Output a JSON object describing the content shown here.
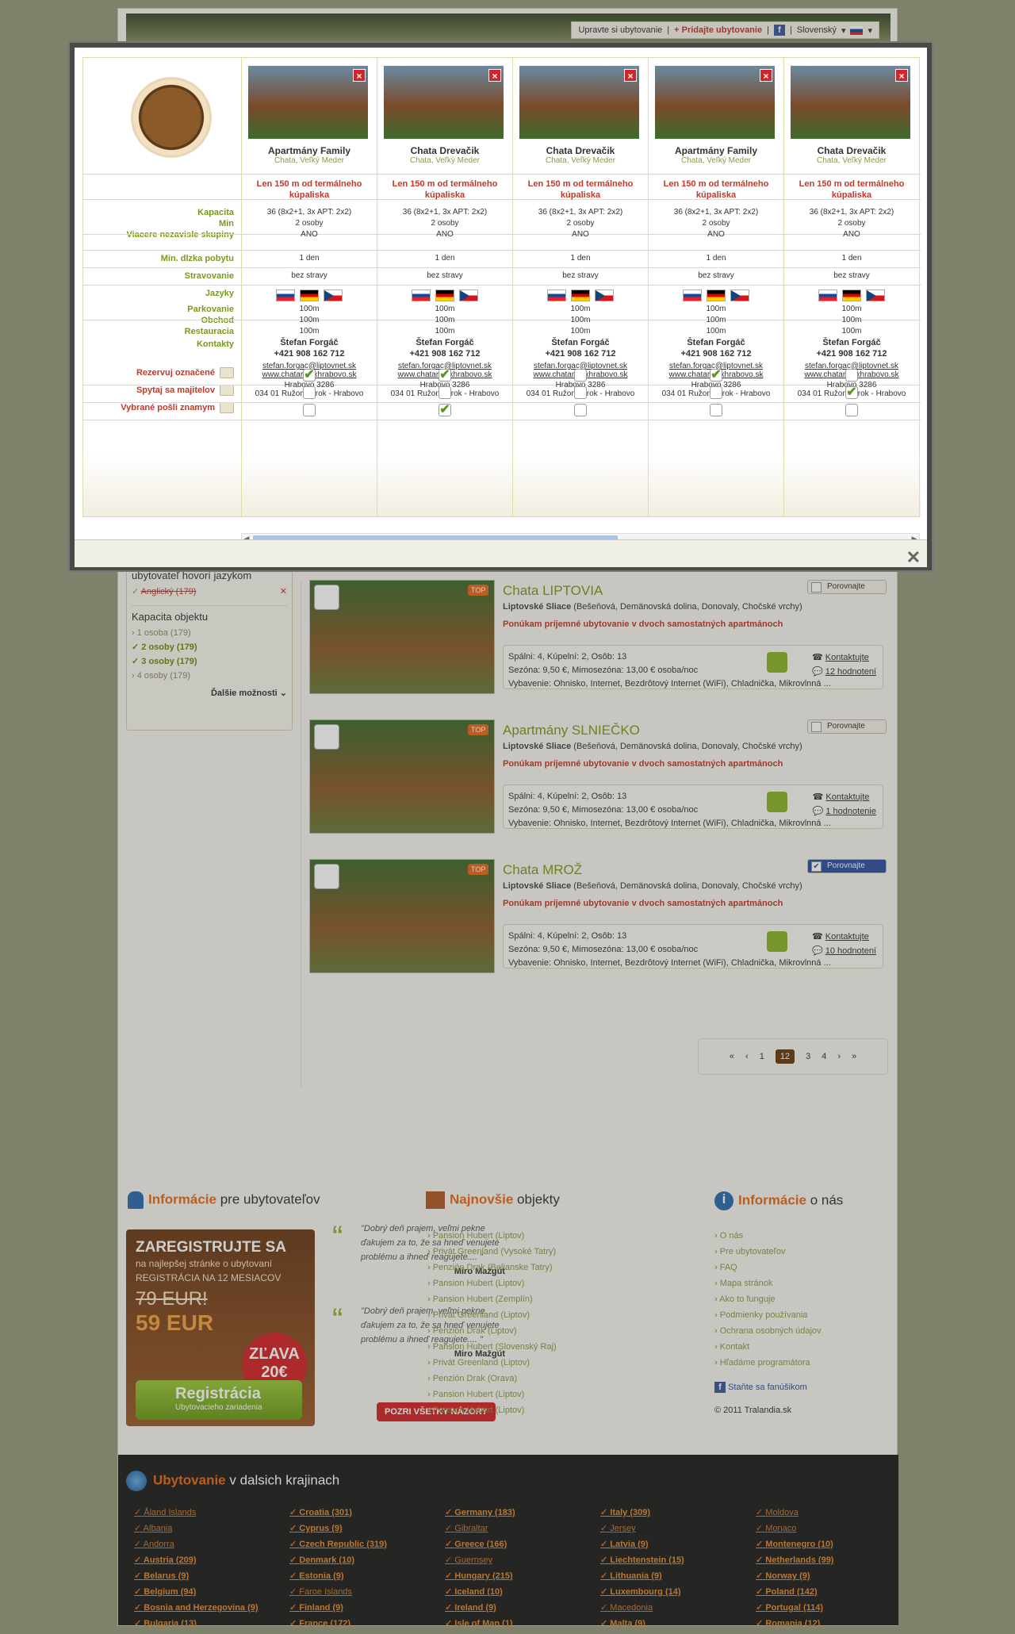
{
  "header": {
    "customize": "Upravte si ubytovanie",
    "add": "+ Pridajte ubytovanie",
    "fb": "f",
    "lang": "Slovenský"
  },
  "sidebar": {
    "lang_title": "ubytovateľ hovorí jazykom",
    "lang_item": "Anglický (179)",
    "capacity_title": "Kapacita objektu",
    "capacity": [
      {
        "label": "1 osoba (179)",
        "on": false
      },
      {
        "label": "2 osoby (179)",
        "on": true
      },
      {
        "label": "3 osoby (179)",
        "on": true
      },
      {
        "label": "4 osoby (179)",
        "on": false
      }
    ],
    "more": "Ďalšie možnosti"
  },
  "listings": [
    {
      "title": "Chata LIPTOVIA",
      "loc_bold": "Liptovské Sliace",
      "loc": " (Bešeňová, Demänovská dolina, Donovaly, Chočské vrchy)",
      "offer": "Ponúkam príjemné ubytovanie v dvoch samostatných apartmánoch",
      "beds": "Spálni: 4, Kúpelní: 2, Osôb: 13",
      "season": "Sezóna: 9,50 €, Mimosezóna: 13,00 € osoba/noc",
      "equip": "Vybavenie: Ohnisko, Internet, Bezdrôtový Internet (WiFi), Chladnička, Mikrovlnná ...",
      "contact": "Kontaktujte",
      "reviews": "12 hodnotení",
      "compare": "Porovnajte",
      "compare_on": false,
      "top": "TOP"
    },
    {
      "title": "Apartmány SLNIEČKO",
      "loc_bold": "Liptovské Sliace",
      "loc": " (Bešeňová, Demänovská dolina, Donovaly, Chočské vrchy)",
      "offer": "Ponúkam príjemné ubytovanie v dvoch samostatných apartmánoch",
      "beds": "Spálni: 4, Kúpelní: 2, Osôb: 13",
      "season": "Sezóna: 9,50 €, Mimosezóna: 13,00 € osoba/noc",
      "equip": "Vybavenie: Ohnisko, Internet, Bezdrôtový Internet (WiFi), Chladnička, Mikrovlnná ...",
      "contact": "Kontaktujte",
      "reviews": "1 hodnotenie",
      "compare": "Porovnajte",
      "compare_on": false,
      "top": "TOP"
    },
    {
      "title": "Chata MROŽ",
      "loc_bold": "Liptovské Sliace",
      "loc": " (Bešeňová, Demänovská dolina, Donovaly, Chočské vrchy)",
      "offer": "Ponúkam príjemné ubytovanie v dvoch samostatných apartmánoch",
      "beds": "Spálni: 4, Kúpelní: 2, Osôb: 13",
      "season": "Sezóna: 9,50 €, Mimosezóna: 13,00 € osoba/noc",
      "equip": "Vybavenie: Ohnisko, Internet, Bezdrôtový Internet (WiFi), Chladnička, Mikrovlnná ...",
      "contact": "Kontaktujte",
      "reviews": "10 hodnotení",
      "compare": "Porovnajte",
      "compare_on": true,
      "top": "TOP"
    }
  ],
  "pager": {
    "first": "«",
    "prev": "‹",
    "pages": [
      "1",
      "12",
      "3",
      "4"
    ],
    "current": "12",
    "next": "›",
    "last": "»"
  },
  "footer": {
    "info_title_b": "Informácie",
    "info_title": " pre ubytovateľov",
    "new_title_b": "Najnovšie",
    "new_title": " objekty",
    "about_title_b": "Informácie",
    "about_title": " o nás",
    "reg": {
      "a": "ZAREGISTRUJTE SA",
      "b": "na najlepšej stránke o ubytovaní",
      "c": "REGISTRÁCIA NA 12 MESIACOV",
      "old": "79 EUR!",
      "new": "59 EUR",
      "badge_a": "ZĽAVA",
      "badge_b": "20€",
      "btn": "Registrácia",
      "btn_sub": "Ubytovacieho zariadenia"
    },
    "quotes": [
      {
        "text": "\"Dobrý deň prajem, veľmi pekne ďakujem za to, že sa hneď venujete problému a ihneď reagujete.... \"",
        "author": "Miro Mažgút"
      },
      {
        "text": "\"Dobrý deň prajem, veľmi pekne ďakujem za to, že sa hneď venujete problému a ihneď reagujete.... \"",
        "author": "Miro Mažgút"
      }
    ],
    "all_opinions": "POZRI VŠETKY NÁZORY",
    "newest": [
      "Pansion Hubert (Liptov)",
      "Privát Greenland (Vysoké Tatry)",
      "Penzión Drak (Belianske Tatry)",
      "Pansion Hubert (Liptov)",
      "Pansion Hubert (Zemplín)",
      "Privát Greenland (Liptov)",
      "Penzión Drak (Liptov)",
      "Pansion Hubert (Slovenský Raj)",
      "Privát Greenland (Liptov)",
      "Penzión Drak (Orava)",
      "Pansion Hubert (Liptov)",
      "Pansion Hubert (Liptov)"
    ],
    "about": [
      "O nás",
      "Pre ubytovateľov",
      "FAQ",
      "Mapa stránok",
      "Ako to funguje",
      "Podmienky používania",
      "Ochrana osobných údajov",
      "Kontakt",
      "Hľadáme programátora"
    ],
    "fan": "Staňte sa fanúšikom",
    "copy": "© 2011 Tralandia.sk"
  },
  "countries": {
    "title_b": "Ubytovanie",
    "title": " v dalsich krajinach",
    "cols": [
      [
        {
          "n": "Åland Islands",
          "b": false
        },
        {
          "n": "Albania",
          "b": false
        },
        {
          "n": "Andorra",
          "b": false
        },
        {
          "n": "Austria (209)",
          "b": true
        },
        {
          "n": "Belarus (9)",
          "b": true
        },
        {
          "n": "Belgium (94)",
          "b": true
        },
        {
          "n": "Bosnia and Herzegovina (9)",
          "b": true
        },
        {
          "n": "Bulgaria (13)",
          "b": true
        }
      ],
      [
        {
          "n": "Croatia (301)",
          "b": true
        },
        {
          "n": "Cyprus (9)",
          "b": true
        },
        {
          "n": "Czech Republic (319)",
          "b": true
        },
        {
          "n": "Denmark (10)",
          "b": true
        },
        {
          "n": "Estonia (9)",
          "b": true
        },
        {
          "n": "Faroe Islands",
          "b": false
        },
        {
          "n": "Finland (9)",
          "b": true
        },
        {
          "n": "France (172)",
          "b": true
        }
      ],
      [
        {
          "n": "Germany (183)",
          "b": true
        },
        {
          "n": "Gibraltar",
          "b": false
        },
        {
          "n": "Greece (166)",
          "b": true
        },
        {
          "n": "Guernsey",
          "b": false
        },
        {
          "n": "Hungary (215)",
          "b": true
        },
        {
          "n": "Iceland (10)",
          "b": true
        },
        {
          "n": "Ireland (9)",
          "b": true
        },
        {
          "n": "Isle of Man (1)",
          "b": true
        }
      ],
      [
        {
          "n": "Italy (309)",
          "b": true
        },
        {
          "n": "Jersey",
          "b": false
        },
        {
          "n": "Latvia (9)",
          "b": true
        },
        {
          "n": "Liechtenstein (15)",
          "b": true
        },
        {
          "n": "Lithuania (9)",
          "b": true
        },
        {
          "n": "Luxembourg (14)",
          "b": true
        },
        {
          "n": "Macedonia",
          "b": false
        },
        {
          "n": "Malta (9)",
          "b": true
        }
      ],
      [
        {
          "n": "Moldova",
          "b": false
        },
        {
          "n": "Monaco",
          "b": false
        },
        {
          "n": "Montenegro (10)",
          "b": true
        },
        {
          "n": "Netherlands (99)",
          "b": true
        },
        {
          "n": "Norway (9)",
          "b": true
        },
        {
          "n": "Poland (142)",
          "b": true
        },
        {
          "n": "Portugal (114)",
          "b": true
        },
        {
          "n": "Romania (12)",
          "b": true
        }
      ]
    ]
  },
  "compare": {
    "labels": {
      "capacity": "Kapacita",
      "min": "Min",
      "groups": "Viacere nezavisle skupiny",
      "stay": "Min. dlzka pobytu",
      "food": "Stravovanie",
      "langs": "Jazyky",
      "parking": "Parkovanie",
      "shop": "Obchod",
      "rest": "Restauracia",
      "contacts": "Kontakty",
      "reserve": "Rezervuj označené",
      "ask": "Spytaj sa majitelov",
      "send": "Vybrané pošli znamym"
    },
    "items": [
      {
        "name": "Apartmány Family",
        "type": "Chata, Veľký Meder",
        "dist": "Len 150 m od termálneho kúpaliska",
        "cap": "36 (8x2+1, 3x APT: 2x2)",
        "min": "2 osoby",
        "groups": "ANO",
        "stay": "1 den",
        "food": "bez stravy",
        "park": "100m",
        "shop": "100m",
        "rest": "100m",
        "owner": "Štefan Forgáč",
        "phone": "+421 908 162 712",
        "email": "stefan.forgac@liptovnet.sk",
        "web": "www.chatarelaxhrabovo.sk",
        "addr1": "Hrabovo 3286",
        "addr2": "034 01 Ružomberok - Hrabovo",
        "reserve": true,
        "ask": false,
        "send": false
      },
      {
        "name": "Chata Drevačik",
        "type": "Chata, Veľký Meder",
        "dist": "Len 150 m od termálneho kúpaliska",
        "cap": "36 (8x2+1, 3x APT: 2x2)",
        "min": "2 osoby",
        "groups": "ANO",
        "stay": "1 den",
        "food": "bez stravy",
        "park": "100m",
        "shop": "100m",
        "rest": "100m",
        "owner": "Štefan Forgáč",
        "phone": "+421 908 162 712",
        "email": "stefan.forgac@liptovnet.sk",
        "web": "www.chatarelaxhrabovo.sk",
        "addr1": "Hrabovo 3286",
        "addr2": "034 01 Ružomberok - Hrabovo",
        "reserve": true,
        "ask": false,
        "send": true
      },
      {
        "name": "Chata Drevačik",
        "type": "Chata, Veľký Meder",
        "dist": "Len 150 m od termálneho kúpaliska",
        "cap": "36 (8x2+1, 3x APT: 2x2)",
        "min": "2 osoby",
        "groups": "ANO",
        "stay": "1 den",
        "food": "bez stravy",
        "park": "100m",
        "shop": "100m",
        "rest": "100m",
        "owner": "Štefan Forgáč",
        "phone": "+421 908 162 712",
        "email": "stefan.forgac@liptovnet.sk",
        "web": "www.chatarelaxhrabovo.sk",
        "addr1": "Hrabovo 3286",
        "addr2": "034 01 Ružomberok - Hrabovo",
        "reserve": false,
        "ask": false,
        "send": false
      },
      {
        "name": "Apartmány Family",
        "type": "Chata, Veľký Meder",
        "dist": "Len 150 m od termálneho kúpaliska",
        "cap": "36 (8x2+1, 3x APT: 2x2)",
        "min": "2 osoby",
        "groups": "ANO",
        "stay": "1 den",
        "food": "bez stravy",
        "park": "100m",
        "shop": "100m",
        "rest": "100m",
        "owner": "Štefan Forgáč",
        "phone": "+421 908 162 712",
        "email": "stefan.forgac@liptovnet.sk",
        "web": "www.chatarelaxhrabovo.sk",
        "addr1": "Hrabovo 3286",
        "addr2": "034 01 Ružomberok - Hrabovo",
        "reserve": true,
        "ask": false,
        "send": false
      },
      {
        "name": "Chata Drevačik",
        "type": "Chata, Veľký Meder",
        "dist": "Len 150 m od termálneho kúpaliska",
        "cap": "36 (8x2+1, 3x APT: 2x2)",
        "min": "2 osoby",
        "groups": "ANO",
        "stay": "1 den",
        "food": "bez stravy",
        "park": "100m",
        "shop": "100m",
        "rest": "100m",
        "owner": "Štefan Forgáč",
        "phone": "+421 908 162 712",
        "email": "stefan.forgac@liptovnet.sk",
        "web": "www.chatarelaxhrabovo.sk",
        "addr1": "Hrabovo 3286",
        "addr2": "034 01 Ružomberok - Hrabovo",
        "reserve": false,
        "ask": true,
        "send": false
      }
    ],
    "close": "✕"
  }
}
